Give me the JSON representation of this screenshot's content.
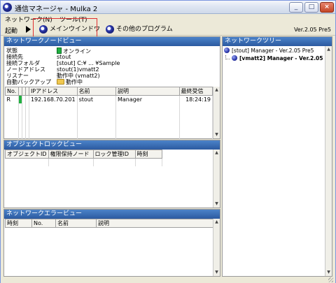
{
  "window": {
    "title": "通信マネージャ - Mulka 2",
    "buttons": [
      "_",
      "□",
      "×"
    ]
  },
  "menu": [
    "ネットワーク(N)",
    "ツール(T)"
  ],
  "toolbar": {
    "launch_label": "起動",
    "main_window": "メインウインドウ",
    "other_programs": "その他のプログラム",
    "version": "Ver.2.05 Pre5"
  },
  "node_view": {
    "title": "ネットワークノードビュー",
    "info": [
      {
        "label": "状態",
        "value": "オンライン"
      },
      {
        "label": "接続先",
        "value": "stout"
      },
      {
        "label": "接続フォルダ",
        "value": "[stout] C:¥ ... ¥Sample"
      },
      {
        "label": "ノードアドレス",
        "value": "stout(1)vmatt2"
      },
      {
        "label": "リスナー",
        "value": "動作中 (vmatt2)"
      },
      {
        "label": "自動バックアップ",
        "value": "動作中"
      }
    ],
    "columns": [
      "No.",
      "",
      "",
      "",
      "IPアドレス",
      "名前",
      "説明",
      "最終受信"
    ],
    "rows": [
      {
        "no": "R",
        "ip": "192.168.70.201",
        "name": "stout",
        "desc": "Manager",
        "last": "18:24:19"
      }
    ]
  },
  "tree_view": {
    "title": "ネットワークツリー",
    "items": [
      {
        "text": "[stout] Manager - Ver.2.05 Pre5"
      },
      {
        "text": "[vmatt2] Manager - Ver.2.05"
      }
    ]
  },
  "lock_view": {
    "title": "オブジェクトロックビュー",
    "columns": [
      "オブジェクトID",
      "権限保持ノード",
      "ロック管理ID",
      "時刻"
    ]
  },
  "error_view": {
    "title": "ネットワークエラービュー",
    "columns": [
      "時刻",
      "No.",
      "名前",
      "説明"
    ]
  },
  "colors": {
    "header": "#2c5aa0",
    "status_online": "#20b040",
    "highlight": "#e03030"
  }
}
